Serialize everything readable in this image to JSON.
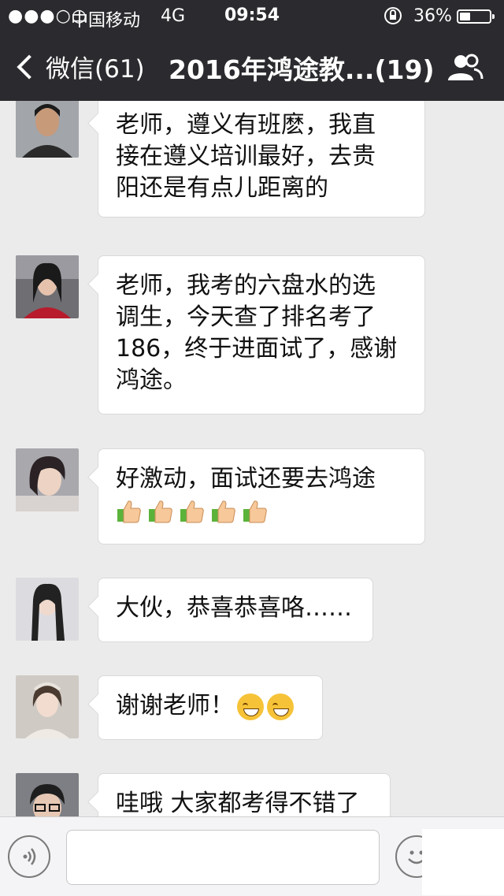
{
  "status_bar": {
    "signal": "●●●○○",
    "carrier": "中国移动",
    "network": "4G",
    "time": "09:54",
    "battery_percent": "36%",
    "battery_level": 0.36
  },
  "nav": {
    "back_label": "微信(61)",
    "title": "2016年鸿途教...(19)"
  },
  "messages": [
    {
      "avatar": "avatar-man",
      "lines": [
        "老师，遵义有班麽，我直",
        "接在遵义培训最好，去贵",
        "阳还是有点儿距离的"
      ]
    },
    {
      "avatar": "avatar-woman-red",
      "lines": [
        "老师，我考的六盘水的选",
        "调生，今天查了排名考了",
        "186，终于进面试了，感谢",
        "鸿途。"
      ]
    },
    {
      "avatar": "avatar-woman-selfie",
      "lines": [
        "好激动，面试还要去鸿途"
      ],
      "emojis": [
        "thumbs-up",
        "thumbs-up",
        "thumbs-up",
        "thumbs-up",
        "thumbs-up"
      ]
    },
    {
      "avatar": "avatar-woman-longhair",
      "lines": [
        "大伙，恭喜恭喜咯……"
      ]
    },
    {
      "avatar": "avatar-girl-headband",
      "lines": [
        "谢谢老师！"
      ],
      "trailing_emojis": [
        "grin",
        "grin"
      ]
    },
    {
      "avatar": "avatar-woman-glasses",
      "lines": [
        "哇哦 大家都考得不错了"
      ]
    }
  ],
  "colors": {
    "header": "#2b2b2f",
    "background": "#ebebeb",
    "bubble": "#ffffff"
  }
}
